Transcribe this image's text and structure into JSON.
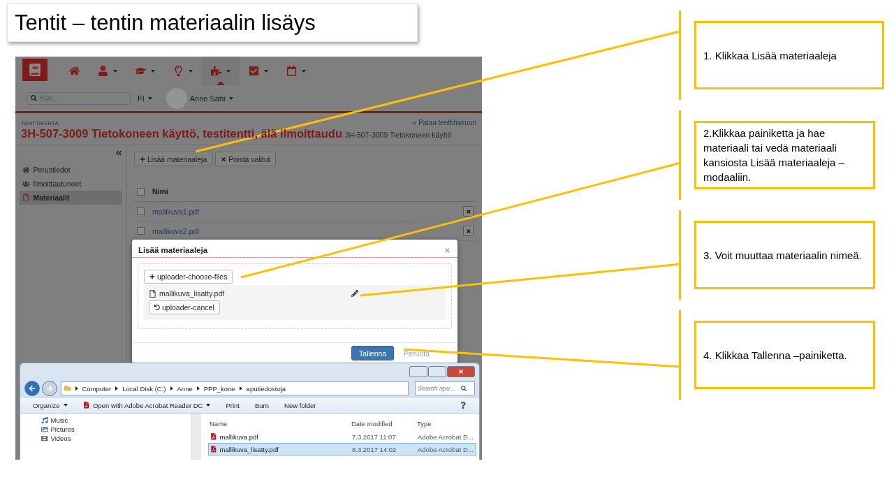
{
  "title": "Tentit – tentin materiaalin lisäys",
  "app": {
    "nav": [
      {
        "kind": "home",
        "caret": false,
        "selected": false
      },
      {
        "kind": "user",
        "caret": true,
        "selected": false
      },
      {
        "kind": "graduation",
        "caret": true,
        "selected": false
      },
      {
        "kind": "lightbulb",
        "caret": true,
        "selected": false
      },
      {
        "kind": "puzzle",
        "caret": true,
        "selected": true
      },
      {
        "kind": "check",
        "caret": true,
        "selected": false
      },
      {
        "kind": "calendar",
        "caret": true,
        "selected": false
      }
    ],
    "search": {
      "placeholder": "Hae..."
    },
    "language": "FI",
    "user": "Anne Sahi",
    "label": "TENTTIKERTA",
    "heading": "3H-507-3009 Tietokoneen käyttö, testitentti, älä ilmoittaudu",
    "subheading": "3H-507-3009 Tietokoneen käyttö",
    "back_link": "« Palaa tenttihakuun",
    "sidebar": [
      {
        "kind": "home",
        "label": "Perustiedot",
        "selected": false
      },
      {
        "kind": "users",
        "label": "Ilmoittautuneet",
        "selected": false
      },
      {
        "kind": "file",
        "label": "Materiaalit",
        "selected": true
      }
    ],
    "buttons": [
      {
        "kind": "add",
        "label": "Lisää materiaaleja"
      },
      {
        "kind": "remove",
        "label": "Poista valitut"
      }
    ],
    "table": {
      "columns": [
        "Nimi"
      ],
      "all_checked": false,
      "rows": [
        {
          "name": "mallikuva1.pdf",
          "checked": false
        },
        {
          "name": "mallikuva2.pdf",
          "checked": false
        }
      ]
    }
  },
  "modal": {
    "title": "Lisää materiaaleja",
    "choose_button": "uploader-choose-files",
    "file": "mallikuva_lisatty.pdf",
    "cancel_button": "uploader-cancel",
    "save_button": "Tallenna",
    "cancel_link": "Peruuta"
  },
  "explorer": {
    "path": [
      "Computer",
      "Local Disk (C:)",
      "Anne",
      "PPP_kone",
      "aputiedostoja"
    ],
    "search": {
      "placeholder": "Search apu..."
    },
    "toolbar": [
      {
        "kind": "menu",
        "label": "Organize"
      },
      {
        "kind": "open",
        "label": "Open with Adobe Acrobat Reader DC"
      },
      {
        "kind": "plain",
        "label": "Print"
      },
      {
        "kind": "plain",
        "label": "Burn"
      },
      {
        "kind": "plain",
        "label": "New folder"
      }
    ],
    "places": [
      {
        "kind": "music",
        "label": "Music"
      },
      {
        "kind": "pictures",
        "label": "Pictures"
      },
      {
        "kind": "videos",
        "label": "Videos"
      }
    ],
    "columns": [
      "Name",
      "Date modified",
      "Type"
    ],
    "rows": [
      {
        "name": "mallikuva.pdf",
        "date": "7.3.2017 11:07",
        "type": "Adobe Acrobat D...",
        "selected": false
      },
      {
        "name": "mallikuva_lisatty.pdf",
        "date": "8.3.2017 14:02",
        "type": "Adobe Acrobat D...",
        "selected": true
      }
    ]
  },
  "callouts": [
    "1. Klikkaa Lisää materiaaleja",
    "2.Klikkaa painiketta ja hae materiaali tai vedä materiaali kansiosta Lisää materiaaleja –modaaliin.",
    "3. Voit muuttaa materiaalin nimeä.",
    "4. Klikkaa Tallenna –painiketta."
  ]
}
